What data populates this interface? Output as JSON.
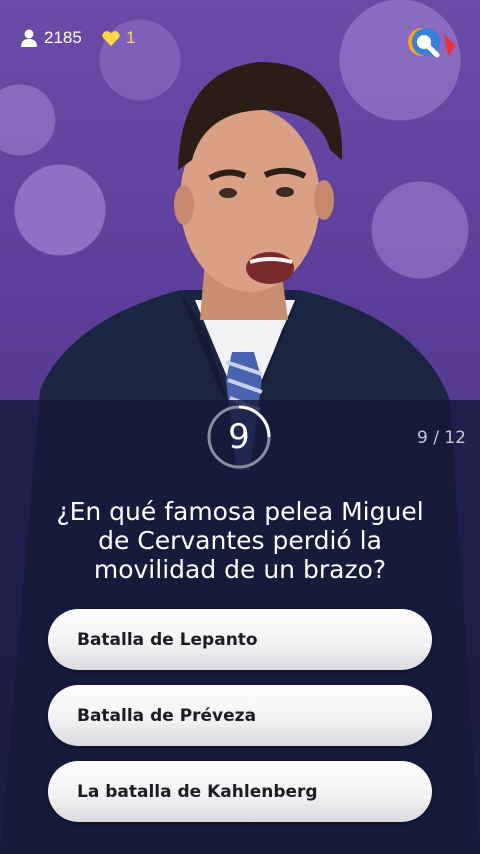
{
  "header": {
    "player_count": "2185",
    "lives": "1",
    "icons": {
      "players": "user-icon",
      "lives": "heart-icon",
      "logo": "q-logo"
    }
  },
  "colors": {
    "lives": "#ffd84a",
    "logo_blue": "#2f7fe0",
    "logo_orange": "#f5a623",
    "logo_red": "#e8323c"
  },
  "timer": {
    "value": "9",
    "remaining_fraction": 0.25
  },
  "question": {
    "progress": "9 / 12",
    "text": "¿En qué famosa pelea Miguel de Cervantes perdió la movilidad de un brazo?"
  },
  "answers": [
    {
      "label": "Batalla de Lepanto"
    },
    {
      "label": "Batalla de Préveza"
    },
    {
      "label": "La batalla de Kahlenberg"
    }
  ]
}
